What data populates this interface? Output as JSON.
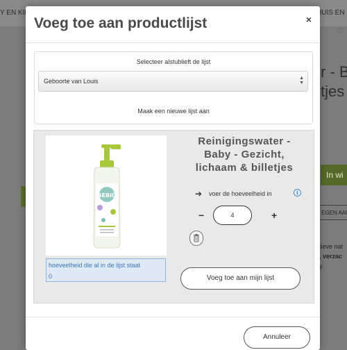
{
  "background": {
    "nav_left": "Y EN KIN",
    "nav_right": "HUIS EN",
    "title_line1": "r - B",
    "title_line2": "tjes",
    "cart_button": "In wi",
    "secondary_button": "EGEN AAN",
    "desc_line1": "tieve nat",
    "desc_line2": ", verzac",
    "desc_line3": "y."
  },
  "modal": {
    "title": "Voeg toe aan productlijst",
    "close": "×",
    "list_section": {
      "label": "Selecteer alstublieft de lijst",
      "selected": "Geboorte van Louis",
      "new_list_link": "Maak een nieuwe lijst aan"
    },
    "product": {
      "name": "Reinigingswater - Baby - Gezicht, lichaam & billetjes",
      "arrow": "➔",
      "quantity_label": "voer de hoeveelheid in",
      "info": "i",
      "minus": "−",
      "quantity": "4",
      "plus": "+",
      "existing_label": "hoeveelheid die al in de lijst staat",
      "existing_value": "0",
      "add_button": "Voeg toe aan mijn lijst",
      "image_brand": "BEBIO"
    },
    "cancel_button": "Annuleer"
  },
  "colors": {
    "accent_green": "#a7c83a",
    "link_blue": "#3b74bf"
  }
}
